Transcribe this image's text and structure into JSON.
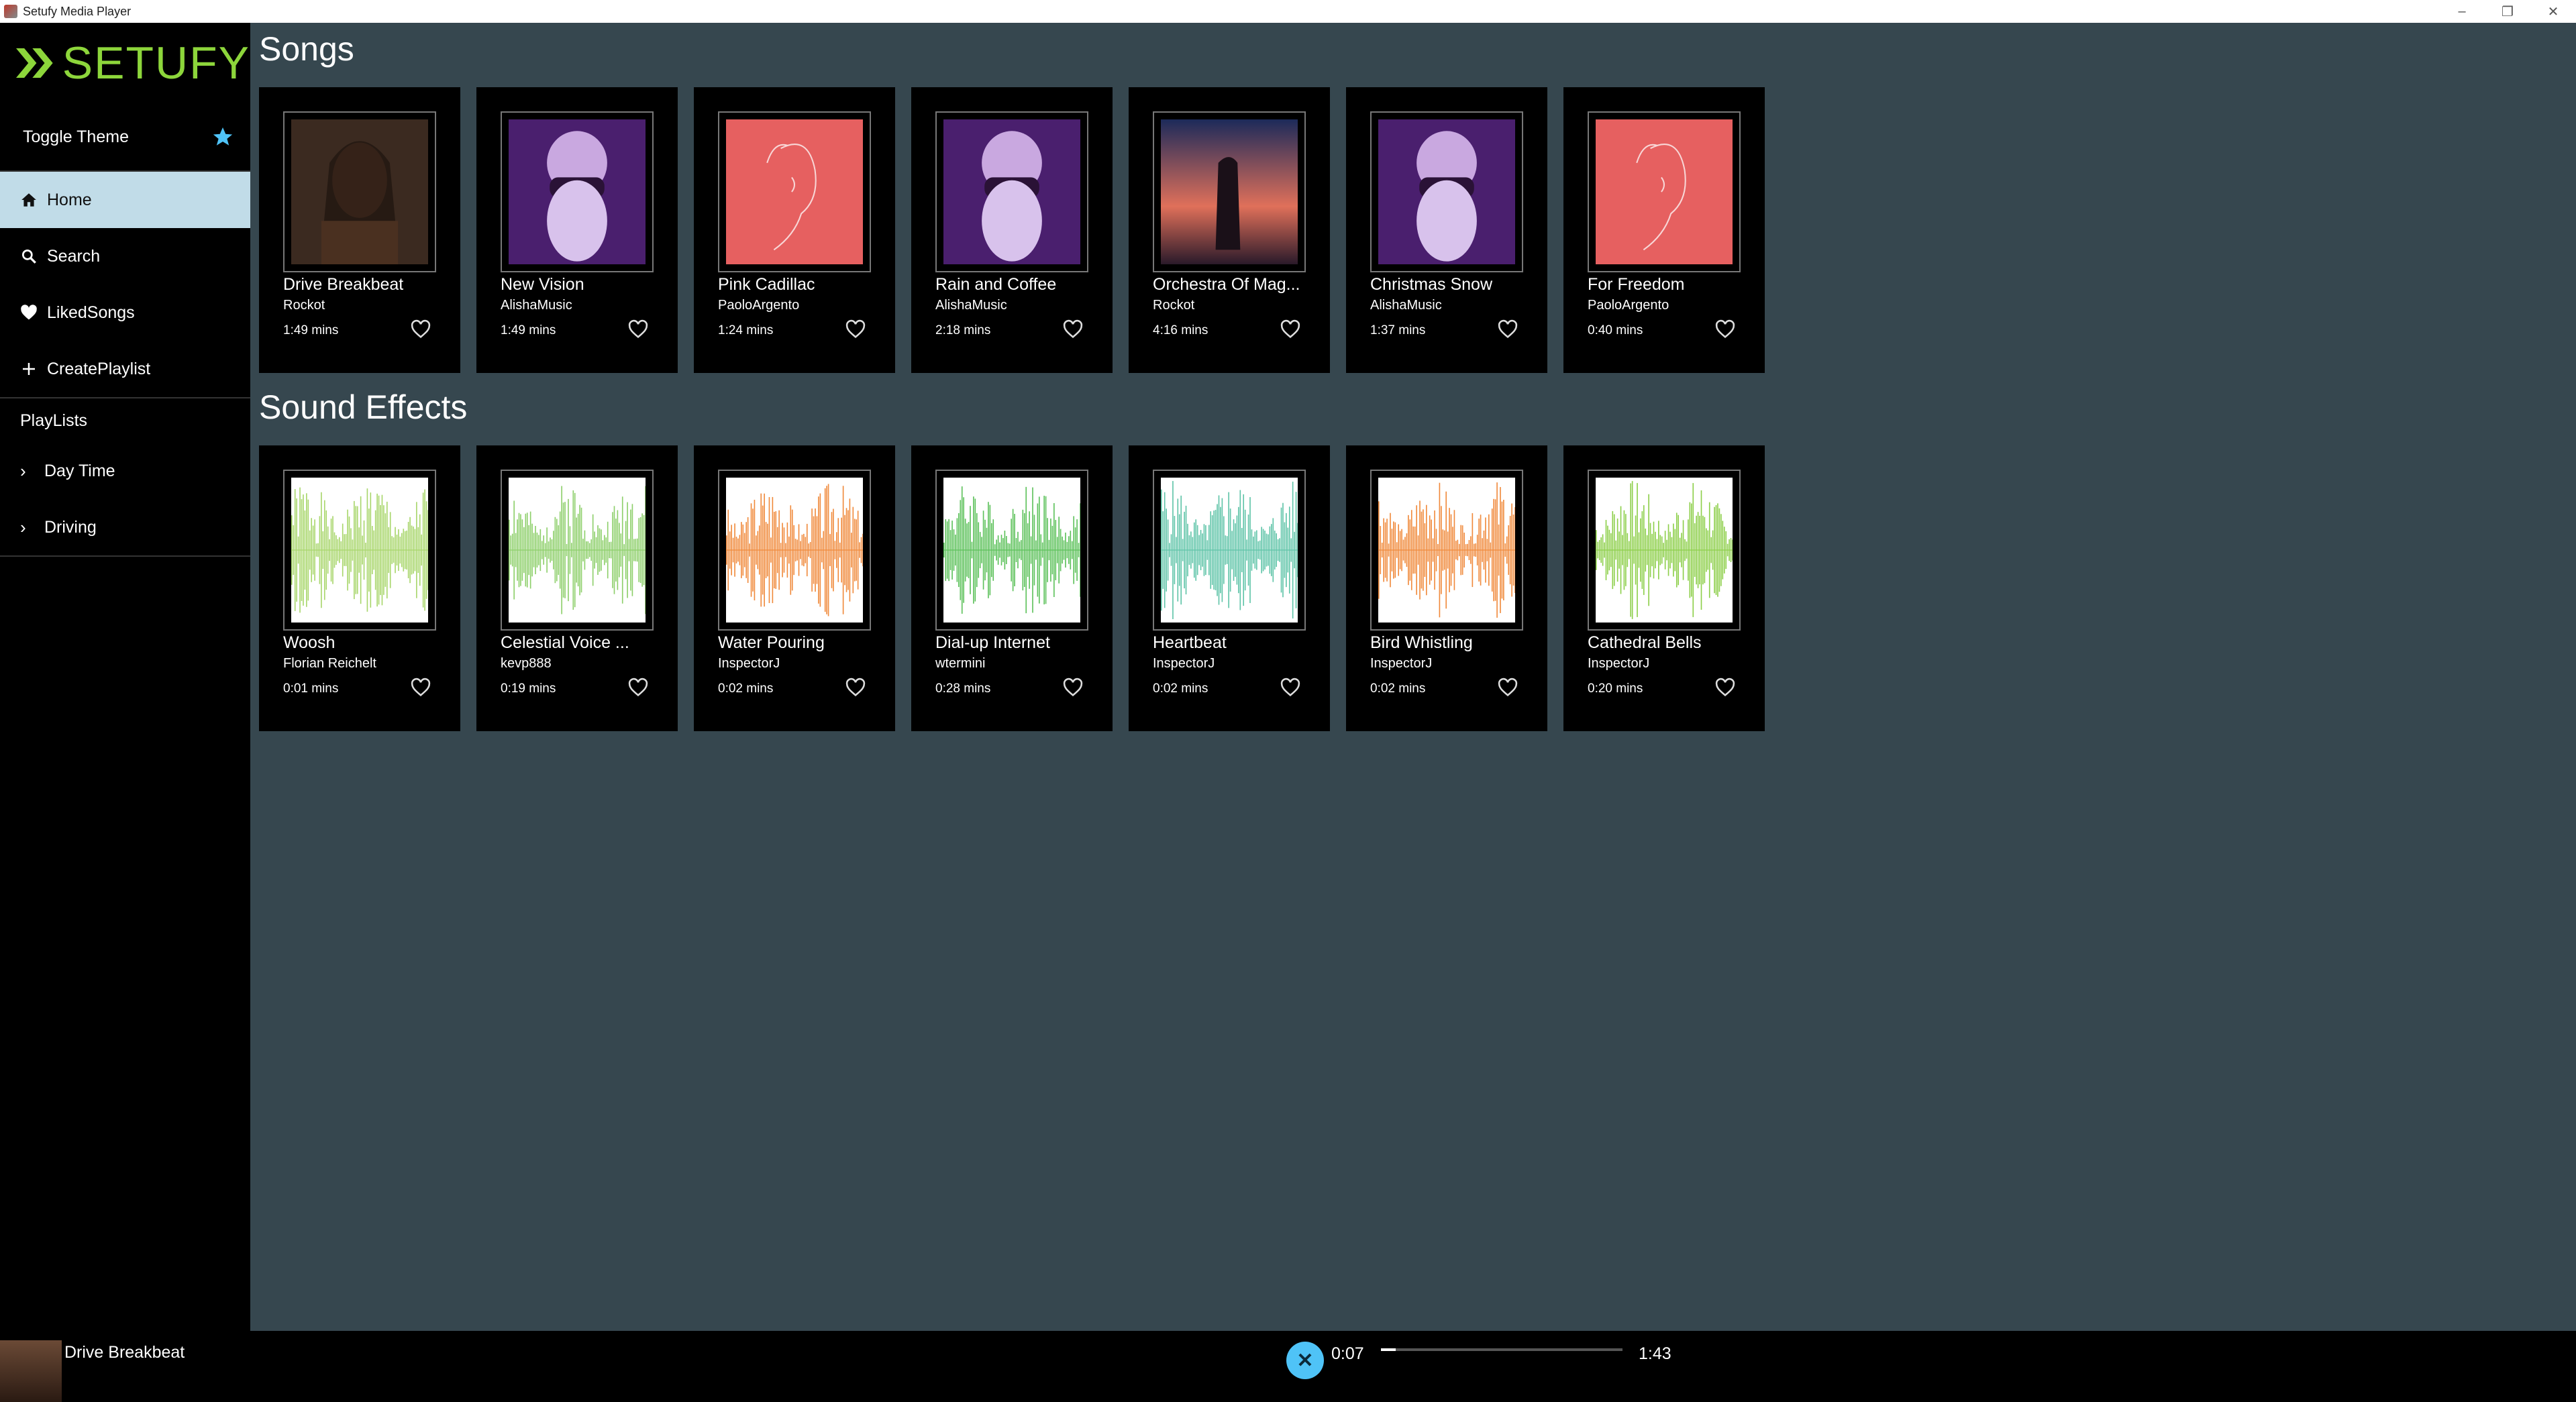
{
  "window": {
    "title": "Setufy Media Player"
  },
  "sidebar": {
    "logo_text": "SETUFY",
    "toggle_theme_label": "Toggle Theme",
    "nav": [
      {
        "label": "Home",
        "icon": "home-icon",
        "active": true
      },
      {
        "label": "Search",
        "icon": "search-icon"
      },
      {
        "label": "LikedSongs",
        "icon": "heart-icon"
      },
      {
        "label": "CreatePlaylist",
        "icon": "plus-icon"
      }
    ],
    "playlists_label": "PlayLists",
    "playlists": [
      {
        "label": "Day Time"
      },
      {
        "label": "Driving"
      }
    ]
  },
  "main": {
    "songs_title": "Songs",
    "sound_effects_title": "Sound Effects",
    "songs": [
      {
        "name": "Drive Breakbeat",
        "artist": "Rockot",
        "duration": "1:49 mins",
        "art": "portrait"
      },
      {
        "name": "New Vision",
        "artist": "AlishaMusic",
        "duration": "1:49 mins",
        "art": "statue"
      },
      {
        "name": "Pink Cadillac",
        "artist": "PaoloArgento",
        "duration": "1:24 mins",
        "art": "sketch"
      },
      {
        "name": "Rain and Coffee",
        "artist": "AlishaMusic",
        "duration": "2:18 mins",
        "art": "statue"
      },
      {
        "name": "Orchestra Of Mag...",
        "artist": "Rockot",
        "duration": "4:16 mins",
        "art": "sunset"
      },
      {
        "name": "Christmas Snow",
        "artist": "AlishaMusic",
        "duration": "1:37 mins",
        "art": "statue"
      },
      {
        "name": "For Freedom",
        "artist": "PaoloArgento",
        "duration": "0:40 mins",
        "art": "sketch"
      }
    ],
    "sound_effects": [
      {
        "name": "Woosh",
        "artist": "Florian Reichelt",
        "duration": "0:01 mins",
        "color": "#a8d66b"
      },
      {
        "name": "Celestial Voice ...",
        "artist": "kevp888",
        "duration": "0:19 mins",
        "color": "#8dcf6a"
      },
      {
        "name": "Water Pouring",
        "artist": "InspectorJ",
        "duration": "0:02 mins",
        "color": "#f08a3c"
      },
      {
        "name": "Dial-up Internet",
        "artist": "wtermini",
        "duration": "0:28 mins",
        "color": "#5cc15a"
      },
      {
        "name": "Heartbeat",
        "artist": "InspectorJ",
        "duration": "0:02 mins",
        "color": "#5fc4a8"
      },
      {
        "name": "Bird Whistling",
        "artist": "InspectorJ",
        "duration": "0:02 mins",
        "color": "#f08a3c"
      },
      {
        "name": "Cathedral Bells",
        "artist": "InspectorJ",
        "duration": "0:20 mins",
        "color": "#8dcf4a"
      }
    ]
  },
  "player": {
    "track_name": "Drive Breakbeat",
    "elapsed": "0:07",
    "total": "1:43",
    "progress": 0.06
  },
  "colors": {
    "accent": "#8dd63b",
    "active_nav": "#c1dce8",
    "player_button": "#4fc3f7",
    "main_bg": "#36474f"
  }
}
